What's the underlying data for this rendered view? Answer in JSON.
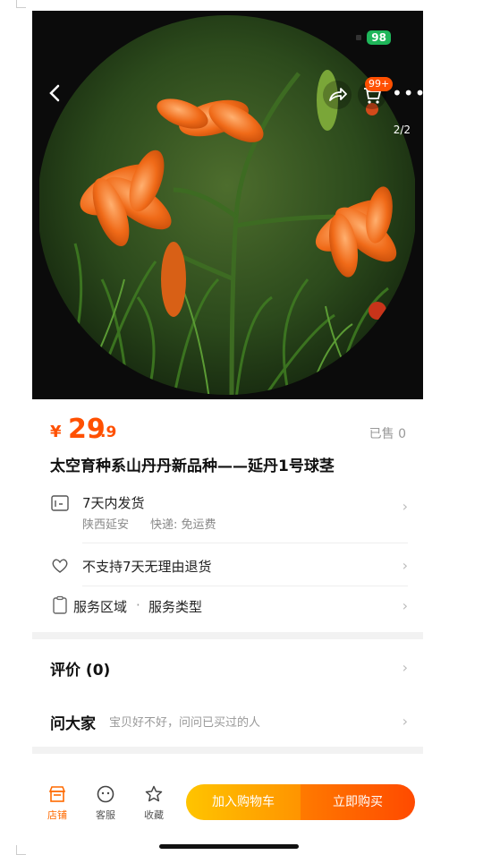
{
  "status": {
    "battery": "98"
  },
  "nav": {
    "image_counter": "2/2",
    "cart_badge": "99+"
  },
  "product": {
    "currency": "¥",
    "price_int": "29",
    "price_dec": ".9",
    "sold": "已售 0",
    "title": "太空育种系山丹丹新品种——延丹1号球茎"
  },
  "shipping": {
    "line1": "7天内发货",
    "origin": "陕西延安",
    "express": "快递: 免运费"
  },
  "returns": {
    "text": "不支持7天无理由退货"
  },
  "service": {
    "area": "服务区域",
    "dot": "·",
    "type": "服务类型"
  },
  "reviews": {
    "label": "评价 (0)"
  },
  "ask": {
    "label": "问大家",
    "hint": "宝贝好不好，问问已买过的人"
  },
  "bottom": {
    "shop": "店铺",
    "service": "客服",
    "favorite": "收藏",
    "add_to_cart": "加入购物车",
    "buy_now": "立即购买"
  }
}
